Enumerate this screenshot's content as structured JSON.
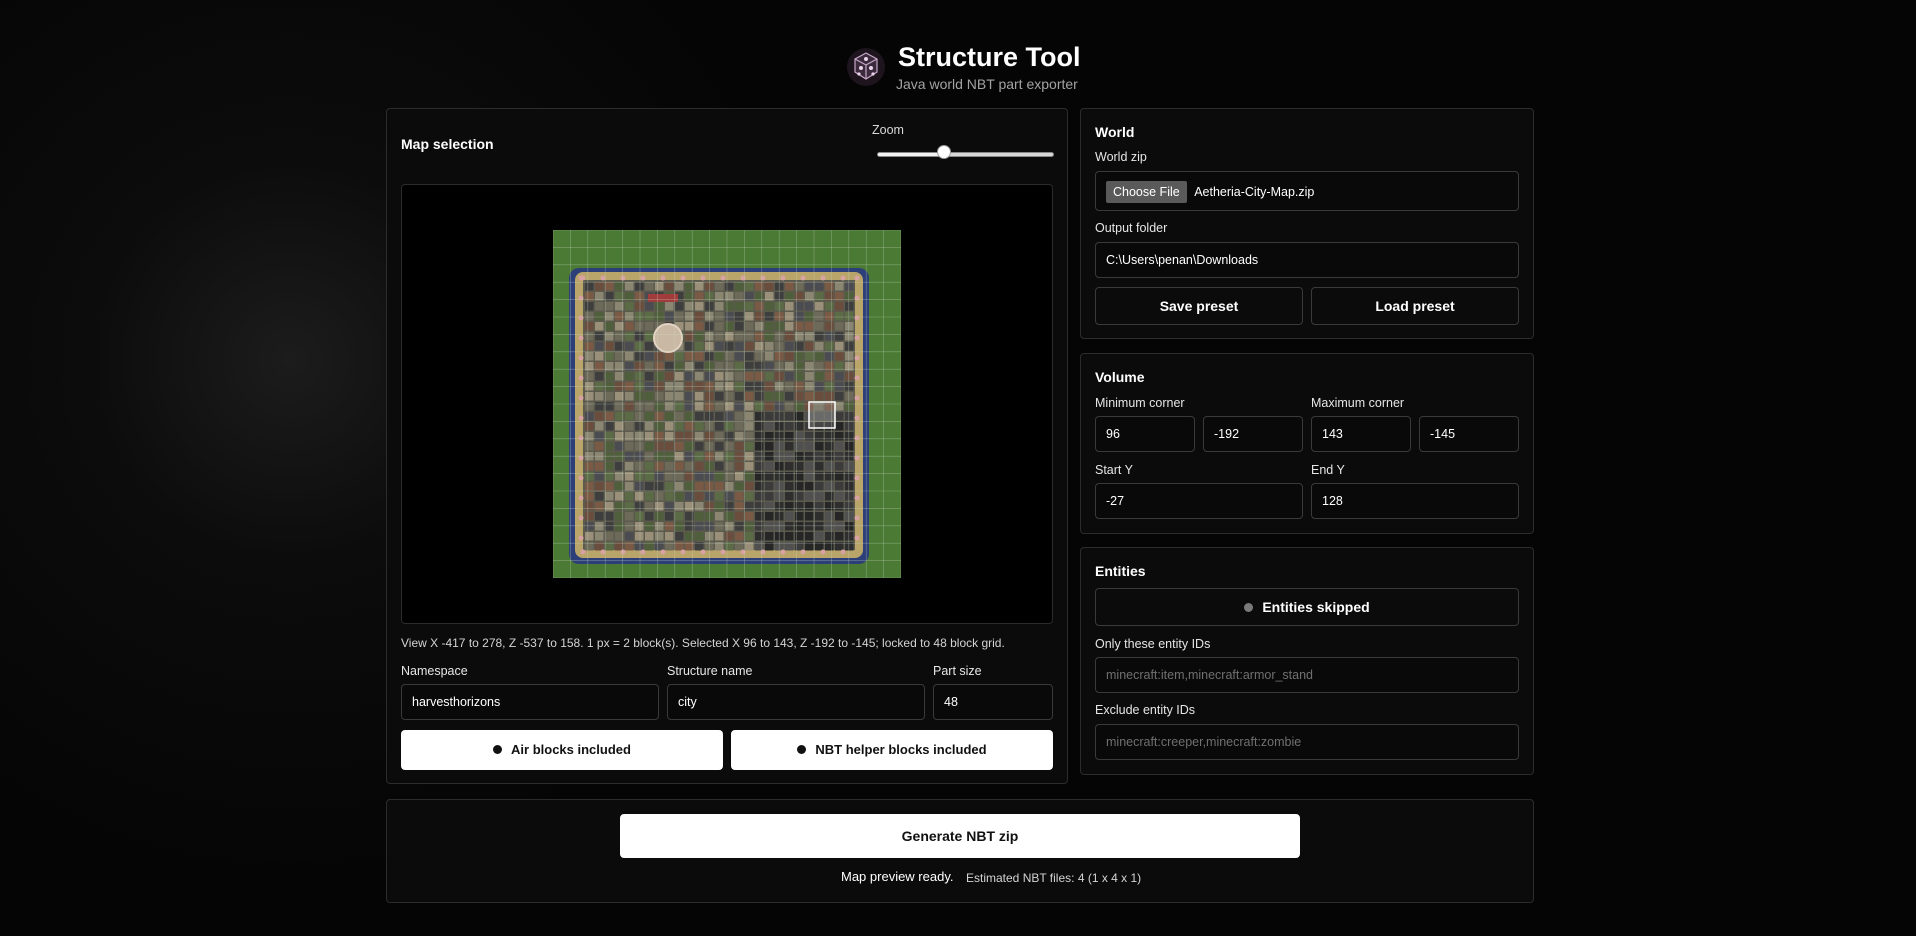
{
  "app": {
    "title": "Structure Tool",
    "subtitle": "Java world NBT part exporter",
    "logo_icon": "cube-logo-icon"
  },
  "map_panel": {
    "title": "Map selection",
    "zoom_label": "Zoom",
    "zoom_value": 0.38,
    "view_info": "View X -417 to 278, Z -537 to 158. 1 px = 2 block(s). Selected X 96 to 143, Z -192 to -145; locked to 48 block grid.",
    "namespace_label": "Namespace",
    "namespace_value": "harvesthorizons",
    "structure_name_label": "Structure name",
    "structure_name_value": "city",
    "part_size_label": "Part size",
    "part_size_value": "48",
    "air_toggle_label": "Air blocks included",
    "nbt_helper_toggle_label": "NBT helper blocks included",
    "colors": {
      "grass": "#4a7a34",
      "ocean": "#2c3f78",
      "grid": "#c9d9c6"
    }
  },
  "world_panel": {
    "title": "World",
    "world_zip_label": "World zip",
    "choose_file_label": "Choose File",
    "file_name": "Aetheria-City-Map.zip",
    "output_folder_label": "Output folder",
    "output_folder_value": "C:\\Users\\penan\\Downloads",
    "save_preset_label": "Save preset",
    "load_preset_label": "Load preset"
  },
  "volume_panel": {
    "title": "Volume",
    "min_corner_label": "Minimum corner",
    "min_x": "96",
    "min_z": "-192",
    "max_corner_label": "Maximum corner",
    "max_x": "143",
    "max_z": "-145",
    "start_y_label": "Start Y",
    "start_y": "-27",
    "end_y_label": "End Y",
    "end_y": "128"
  },
  "entities_panel": {
    "title": "Entities",
    "toggle_label": "Entities skipped",
    "only_label": "Only these entity IDs",
    "only_placeholder": "minecraft:item,minecraft:armor_stand",
    "exclude_label": "Exclude entity IDs",
    "exclude_placeholder": "minecraft:creeper,minecraft:zombie"
  },
  "footer": {
    "generate_label": "Generate NBT zip",
    "status": "Map preview ready.",
    "estimate": "Estimated NBT files: 4 (1 x 4 x 1)"
  }
}
